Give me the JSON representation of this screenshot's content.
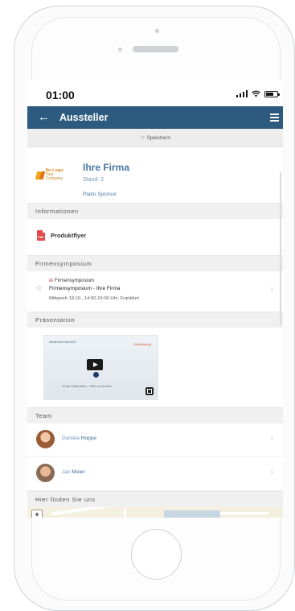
{
  "status": {
    "time": "01:00"
  },
  "appbar": {
    "title": "Aussteller",
    "back_icon": "arrow-left-icon",
    "menu_icon": "menu-icon"
  },
  "save": {
    "label": "Speichern",
    "icon": "star-icon"
  },
  "company": {
    "logo_title": "Ihr Logo",
    "logo_sub": "Your Company",
    "name": "Ihre Firma",
    "stand": "Stand: 2",
    "sponsor": "Platin Sponsor"
  },
  "sections": {
    "informationen": "Informationen",
    "symposium": "Firmensymposium",
    "praesentation": "Präsentation",
    "team": "Team",
    "map": "Hier finden Sie uns"
  },
  "document": {
    "label": "Produktflyer",
    "icon_text": "PDF"
  },
  "event": {
    "tag": "Firmensymposium",
    "title": "Firmensymposium - Ihre Firma",
    "time": "Mittwoch 19.10., 14:00-15:00 Uhr, Frankfurt"
  },
  "video": {
    "top_left": "virtuell-Pulse Web 2022",
    "top_right": "Pulse|Meeting",
    "caption": "vPulse Präsentation - Video on demand"
  },
  "team": [
    {
      "first": "Daniela",
      "last": "Hoppe"
    },
    {
      "first": "Jan",
      "last": "Meier"
    }
  ],
  "map_controls": {
    "zoom_in": "+",
    "zoom_out": "−"
  }
}
